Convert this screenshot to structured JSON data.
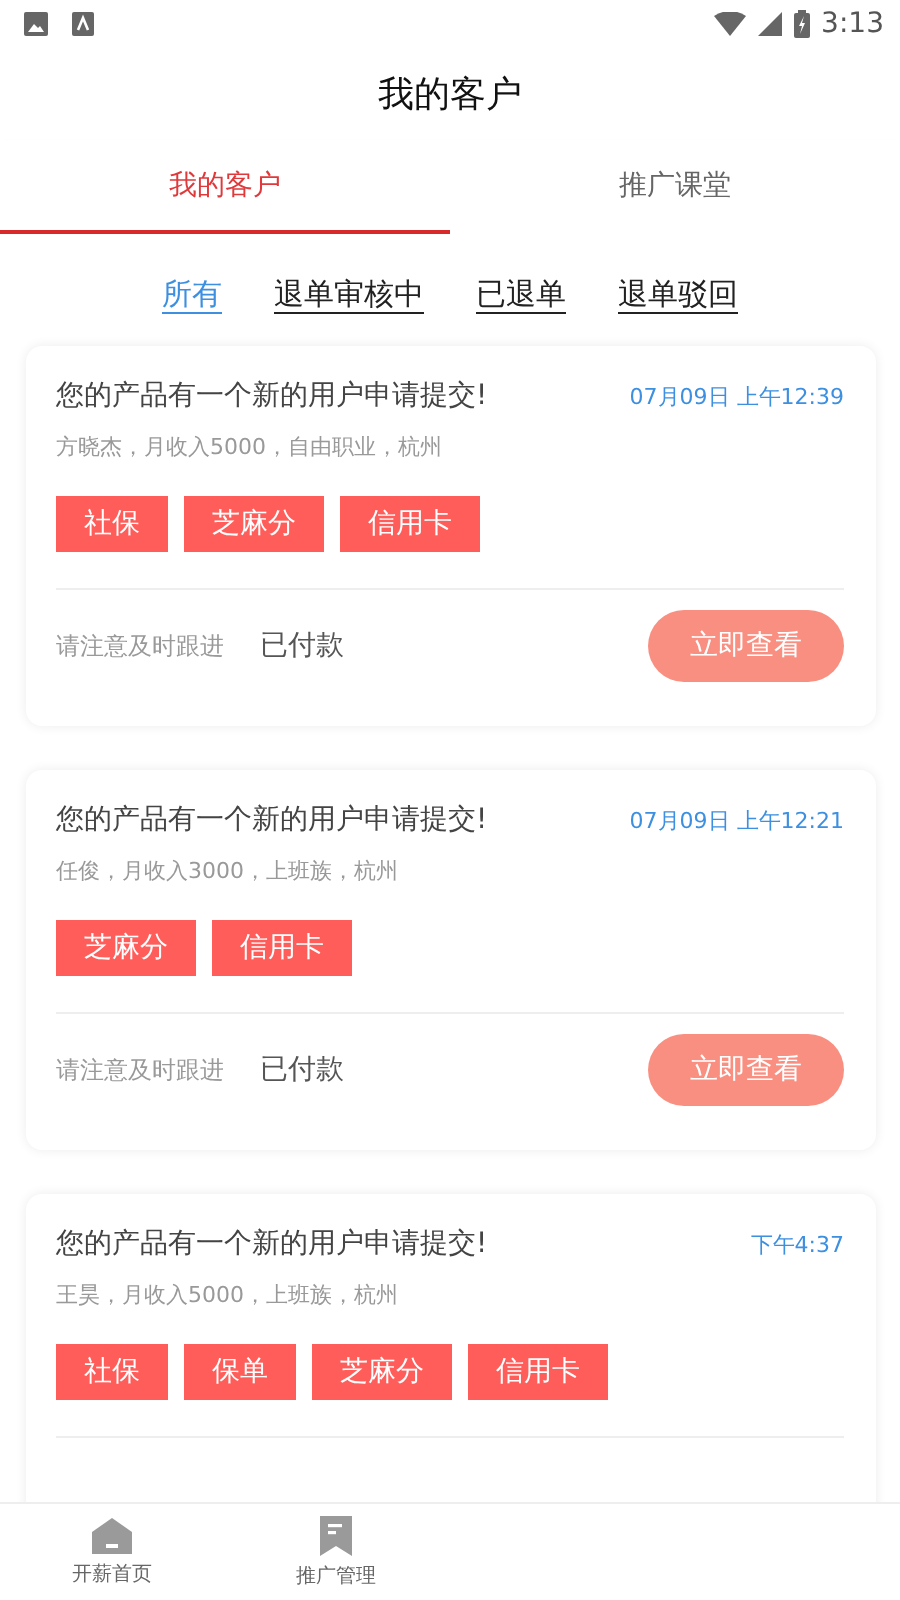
{
  "status_bar": {
    "time": "3:13"
  },
  "header": {
    "title": "我的客户"
  },
  "tabs": [
    {
      "label": "我的客户",
      "selected": true
    },
    {
      "label": "推广课堂",
      "selected": false
    }
  ],
  "filters": [
    {
      "label": "所有",
      "selected": true
    },
    {
      "label": "退单审核中",
      "selected": false
    },
    {
      "label": "已退单",
      "selected": false
    },
    {
      "label": "退单驳回",
      "selected": false
    }
  ],
  "cards": [
    {
      "title": "您的产品有一个新的用户申请提交!",
      "time": "07月09日 上午12:39",
      "details": "方晓杰，月收入5000，自由职业，杭州",
      "tags": [
        "社保",
        "芝麻分",
        "信用卡"
      ],
      "footer": {
        "note": "请注意及时跟进",
        "status": "已付款",
        "button": "立即查看"
      }
    },
    {
      "title": "您的产品有一个新的用户申请提交!",
      "time": "07月09日 上午12:21",
      "details": "任俊，月收入3000，上班族，杭州",
      "tags": [
        "芝麻分",
        "信用卡"
      ],
      "footer": {
        "note": "请注意及时跟进",
        "status": "已付款",
        "button": "立即查看"
      }
    },
    {
      "title": "您的产品有一个新的用户申请提交!",
      "time": "下午4:37",
      "details": "王昊，月收入5000，上班族，杭州",
      "tags": [
        "社保",
        "保单",
        "芝麻分",
        "信用卡"
      ]
    }
  ],
  "bottom_nav": [
    {
      "label": "开薪首页"
    },
    {
      "label": "推广管理"
    }
  ]
}
